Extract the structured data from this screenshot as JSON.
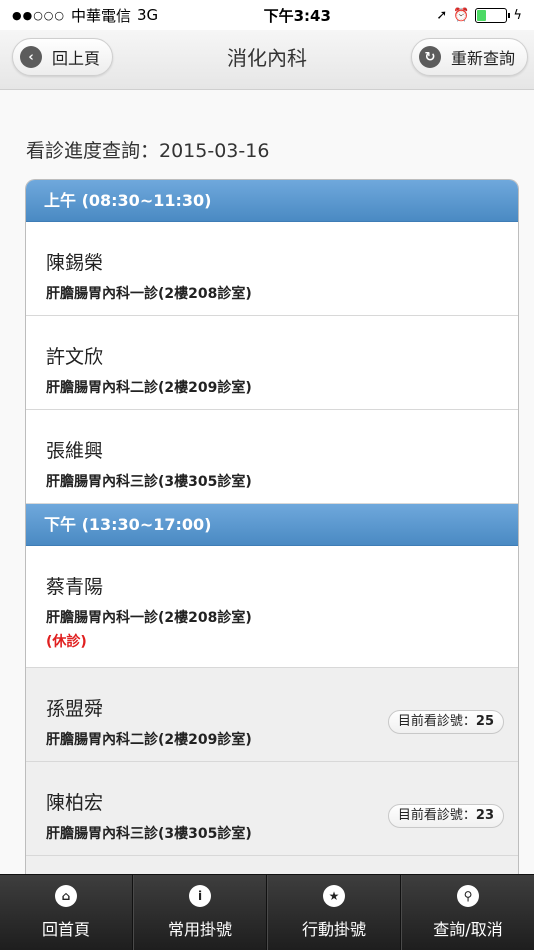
{
  "status_bar": {
    "signal": "●●○○○",
    "carrier": "中華電信",
    "network": "3G",
    "time": "下午3:43"
  },
  "header": {
    "title": "消化內科",
    "back_label": "回上頁",
    "refresh_label": "重新查詢"
  },
  "page": {
    "title": "看診進度查詢：2015-03-16"
  },
  "sessions": [
    {
      "label": "上午 (08:30~11:30)",
      "doctors": [
        {
          "name": "陳錫榮",
          "room": "肝膽腸胃內科一診(2樓208診室)"
        },
        {
          "name": "許文欣",
          "room": "肝膽腸胃內科二診(2樓209診室)"
        },
        {
          "name": "張維興",
          "room": "肝膽腸胃內科三診(3樓305診室)"
        }
      ]
    },
    {
      "label": "下午 (13:30~17:00)",
      "doctors": [
        {
          "name": "蔡青陽",
          "room": "肝膽腸胃內科一診(2樓208診室)",
          "status": "(休診)"
        },
        {
          "name": "孫盟舜",
          "room": "肝膽腸胃內科二診(2樓209診室)",
          "current_label": "目前看診號：",
          "current_number": "25"
        },
        {
          "name": "陳柏宏",
          "room": "肝膽腸胃內科三診(3樓305診室)",
          "current_label": "目前看診號：",
          "current_number": "23"
        }
      ]
    }
  ],
  "tabbar": {
    "items": [
      {
        "label": "回首頁",
        "icon": "home-icon"
      },
      {
        "label": "常用掛號",
        "icon": "info-icon"
      },
      {
        "label": "行動掛號",
        "icon": "star-icon"
      },
      {
        "label": "查詢/取消",
        "icon": "search-icon"
      }
    ]
  },
  "colors": {
    "divider": "#4a8ac3",
    "closed_text": "#e02020",
    "tabbar": "#2a2a2a"
  }
}
